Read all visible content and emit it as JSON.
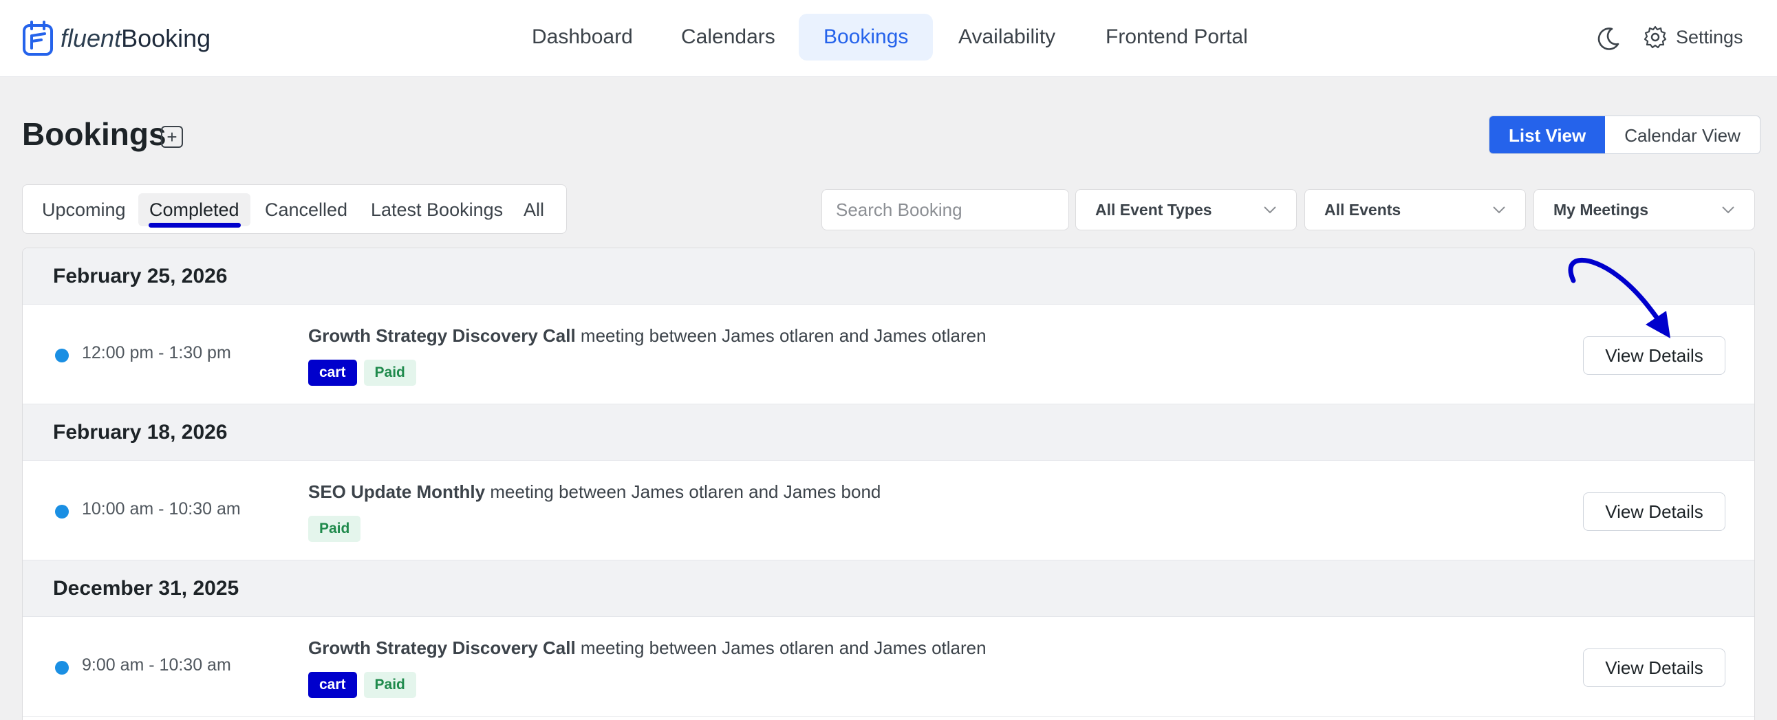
{
  "brand": {
    "name_light": "fluent",
    "name_bold": "Booking"
  },
  "nav": {
    "items": [
      {
        "label": "Dashboard"
      },
      {
        "label": "Calendars"
      },
      {
        "label": "Bookings"
      },
      {
        "label": "Availability"
      },
      {
        "label": "Frontend Portal"
      }
    ],
    "active": "Bookings",
    "settings_label": "Settings",
    "theme_icon": "moon-icon",
    "settings_icon": "gear-icon"
  },
  "page": {
    "title": "Bookings",
    "add_icon": "plus-square-icon",
    "views": {
      "list": "List View",
      "calendar": "Calendar View",
      "active": "List View"
    }
  },
  "tabs": {
    "items": [
      {
        "label": "Upcoming"
      },
      {
        "label": "Completed"
      },
      {
        "label": "Cancelled"
      },
      {
        "label": "Latest Bookings"
      },
      {
        "label": "All"
      }
    ],
    "active": "Completed"
  },
  "filters": {
    "search_placeholder": "Search Booking",
    "event_types": "All Event Types",
    "events": "All Events",
    "meetings": "My Meetings"
  },
  "groups": [
    {
      "date": "February 25, 2026",
      "bookings": [
        {
          "time": "12:00 pm - 1:30 pm",
          "event": "Growth Strategy Discovery Call",
          "desc": "meeting between James otlaren and James otlaren",
          "badges": [
            "cart",
            "Paid"
          ],
          "action": "View Details"
        }
      ]
    },
    {
      "date": "February 18, 2026",
      "bookings": [
        {
          "time": "10:00 am - 10:30 am",
          "event": "SEO Update Monthly",
          "desc": "meeting between James otlaren and James bond",
          "badges": [
            "Paid"
          ],
          "action": "View Details"
        }
      ]
    },
    {
      "date": "December 31, 2025",
      "bookings": [
        {
          "time": "9:00 am - 10:30 am",
          "event": "Growth Strategy Discovery Call",
          "desc": "meeting between James otlaren and James otlaren",
          "badges": [
            "cart",
            "Paid"
          ],
          "action": "View Details"
        }
      ]
    }
  ],
  "colors": {
    "accent": "#2563eb",
    "annotation": "#0000cc",
    "dot": "#1a8fe3",
    "paid_bg": "#e4f5ec",
    "paid_text": "#1f8a4c"
  }
}
